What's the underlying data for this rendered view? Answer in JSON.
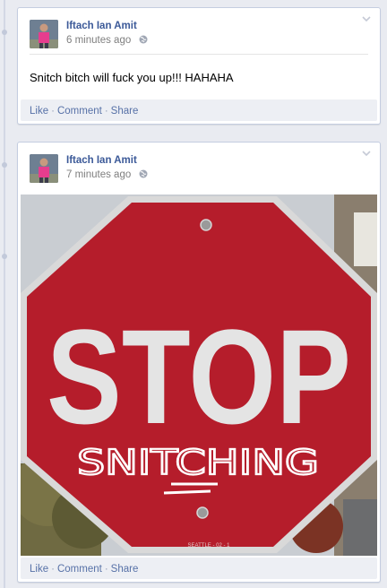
{
  "posts": [
    {
      "author": "Iftach Ian Amit",
      "time": "6 minutes ago",
      "message": "Snitch bitch will fuck you up!!! HAHAHA",
      "actions": {
        "like": "Like",
        "comment": "Comment",
        "share": "Share"
      }
    },
    {
      "author": "Iftach Ian Amit",
      "time": "7 minutes ago",
      "photo": {
        "sign_text": "STOP",
        "graffiti_text": "SNITCHING",
        "plate_text": "SEATTLE - 02 - 1"
      },
      "actions": {
        "like": "Like",
        "comment": "Comment",
        "share": "Share"
      }
    }
  ],
  "icons": {
    "privacy": "globe-icon",
    "menu": "chevron-down-icon"
  },
  "colors": {
    "link": "#3b5998",
    "action_bar": "#edeff4",
    "page_bg": "#e9ebf1",
    "sign_red": "#b51d2b"
  }
}
